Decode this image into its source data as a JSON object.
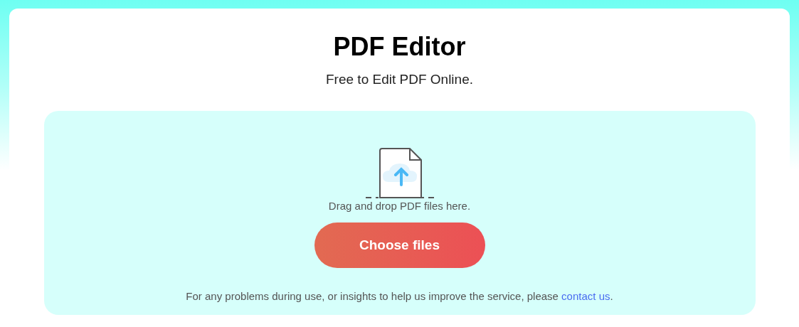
{
  "title": "PDF Editor",
  "subtitle": "Free to Edit PDF Online.",
  "upload": {
    "hint": "Drag and drop PDF files here.",
    "button": "Choose files"
  },
  "footer_note": {
    "before": "For any problems during use, or insights to help us improve the service, please ",
    "link": "contact us",
    "after": "."
  }
}
